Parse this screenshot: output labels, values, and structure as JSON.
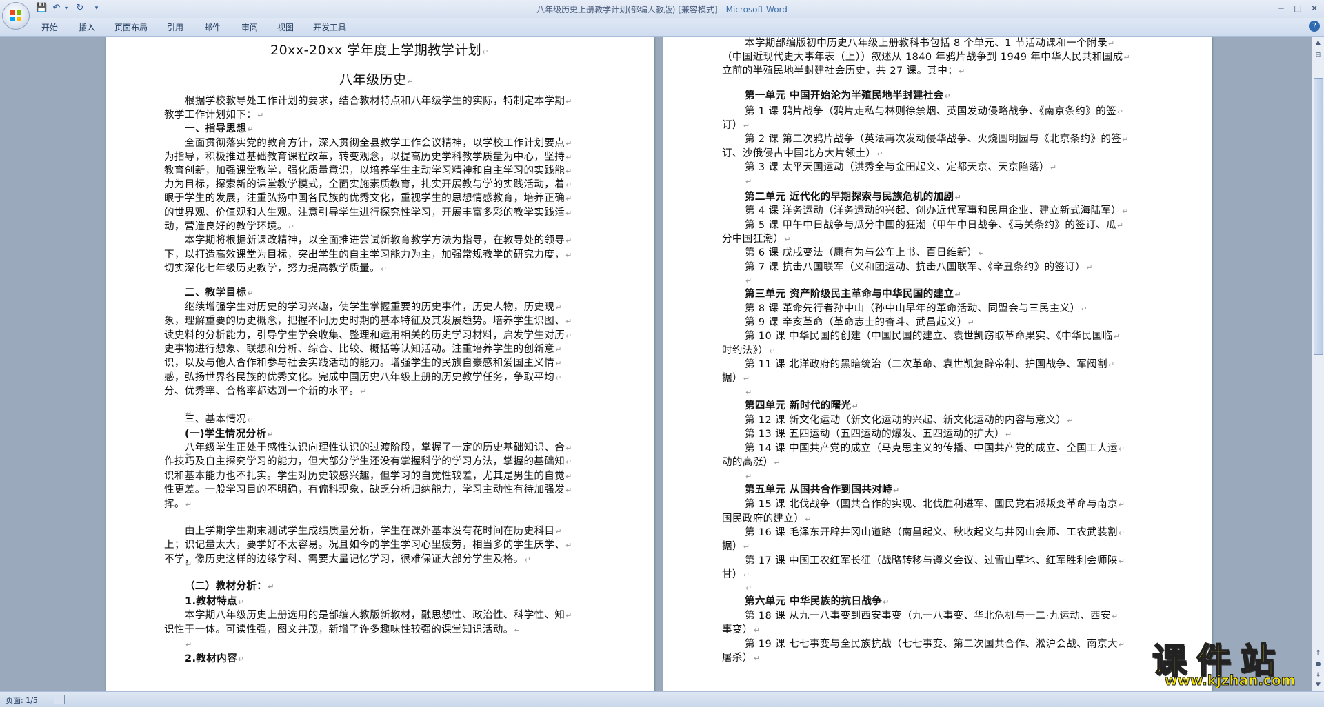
{
  "window": {
    "title": "八年级历史上册教学计划(部编人教版) [兼容模式] - ",
    "app_name": "Microsoft Word",
    "controls": [
      "─",
      "□",
      "✕"
    ]
  },
  "qat": {
    "save_icon": "save-icon",
    "undo_icon": "undo-icon",
    "redo_icon": "redo-icon"
  },
  "ribbon": {
    "tabs": [
      "开始",
      "插入",
      "页面布局",
      "引用",
      "邮件",
      "审阅",
      "视图",
      "开发工具"
    ],
    "help": "?"
  },
  "page1": {
    "lines": [
      {
        "t": "20xx-20xx 学年度上学期教学计划",
        "style": "title"
      },
      {
        "t": "八年级历史",
        "style": "title"
      },
      {
        "t": "根据学校教导处工作计划的要求，结合教材特点和八年级学生的实际，特制定本学期"
      },
      {
        "t": "教学工作计划如下："
      },
      {
        "t": "一、指导思想"
      },
      {
        "t": "全面贯彻落实党的教育方针，深入贯彻全县教学工作会议精神，以学校工作计划要点"
      },
      {
        "t": "为指导，积极推进基础教育课程改革，转变观念，以提高历史学科教学质量为中心，坚持"
      },
      {
        "t": "教育创新，加强课堂教学，强化质量意识，以培养学生主动学习精神和自主学习的实践能"
      },
      {
        "t": "力为目标，探索新的课堂教学模式，全面实施素质教育，扎实开展教与学的实践活动，着"
      },
      {
        "t": "眼于学生的发展，注重弘扬中国各民族的优秀文化，重视学生的思想情感教育，培养正确"
      },
      {
        "t": "的世界观、价值观和人生观。注意引导学生进行探究性学习，开展丰富多彩的教学实践活"
      },
      {
        "t": "动，营造良好的教学环境。"
      },
      {
        "t": "本学期将根据新课改精神，以全面推进尝试新教育教学方法为指导，在教导处的领导"
      },
      {
        "t": "下，以打造高效课堂为目标，突出学生的自主学习能力为主，加强常规教学的研究力度，"
      },
      {
        "t": "切实深化七年级历史教学，努力提高教学质量。"
      },
      {
        "t": "二、教学目标"
      },
      {
        "t": "继续增强学生对历史的学习兴趣，使学生掌握重要的历史事件，历史人物，历史现"
      },
      {
        "t": "象，理解重要的历史概念，把握不同历史时期的基本特征及其发展趋势。培养学生识图、"
      },
      {
        "t": "读史料的分析能力，引导学生学会收集、整理和运用相关的历史学习材料，启发学生对历"
      },
      {
        "t": "史事物进行想象、联想和分析、综合、比较、概括等认知活动。注重培养学生的创新意"
      },
      {
        "t": "识，以及与他人合作和参与社会实践活动的能力。增强学生的民族自豪感和爱国主义情"
      },
      {
        "t": "感，弘扬世界各民族的优秀文化。完成中国历史八年级上册的历史教学任务，争取平均"
      },
      {
        "t": "分、优秀率、合格率都达到一个新的水平。"
      },
      {
        "t": "三、基本情况"
      },
      {
        "t": "(一)学生情况分析"
      },
      {
        "t": "八年级学生正处于感性认识向理性认识的过渡阶段，掌握了一定的历史基础知识、合"
      },
      {
        "t": "作技巧及自主探究学习的能力，但大部分学生还没有掌握科学的学习方法，掌握的基础知"
      },
      {
        "t": "识和基本能力也不扎实。学生对历史较感兴趣，但学习的自觉性较差，尤其是男生的自觉"
      },
      {
        "t": "性更差。一般学习目的不明确，有偏科现象，缺乏分析归纳能力，学习主动性有待加强发"
      },
      {
        "t": "挥。"
      },
      {
        "t": "由上学期学生期末测试学生成绩质量分析，学生在课外基本没有花时间在历史科目"
      },
      {
        "t": "上；识记量太大，要学好不太容易。况且如今的学生学习心里疲劳，相当多的学生厌学、"
      },
      {
        "t": "不学，像历史这样的边缘学科、需要大量记忆学习，很难保证大部分学生及格。"
      },
      {
        "t": "（二）教材分析："
      },
      {
        "t": "1.教材特点"
      },
      {
        "t": "本学期八年级历史上册选用的是部编人教版新教材，融思想性、政治性、科学性、知"
      },
      {
        "t": "识性于一体。可读性强，图文并茂，新增了许多趣味性较强的课堂知识活动。"
      },
      {
        "t": "2.教材内容"
      }
    ]
  },
  "page2": {
    "lines": [
      {
        "t": "本学期部编版初中历史八年级上册教科书包括 8 个单元、1 节活动课和一个附录"
      },
      {
        "t": "（中国近现代史大事年表（上））叙述从 1840 年鸦片战争到 1949 年中华人民共和国成"
      },
      {
        "t": "立前的半殖民地半封建社会历史，共 27 课。其中："
      },
      {
        "t": "第一单元 中国开始沦为半殖民地半封建社会"
      },
      {
        "t": "第 1 课 鸦片战争（鸦片走私与林则徐禁烟、英国发动侵略战争、《南京条约》的签"
      },
      {
        "t": "订）"
      },
      {
        "t": "第 2 课 第二次鸦片战争（英法再次发动侵华战争、火烧圆明园与《北京条约》的签"
      },
      {
        "t": "订、沙俄侵占中国北方大片领土）"
      },
      {
        "t": "第 3 课 太平天国运动（洪秀全与金田起义、定都天京、天京陷落）"
      },
      {
        "t": "第二单元 近代化的早期探索与民族危机的加剧"
      },
      {
        "t": "第 4 课 洋务运动（洋务运动的兴起、创办近代军事和民用企业、建立新式海陆军）"
      },
      {
        "t": "第 5 课 甲午中日战争与瓜分中国的狂潮（甲午中日战争、《马关条约》的签订、瓜"
      },
      {
        "t": "分中国狂潮）"
      },
      {
        "t": "第 6 课 戊戌变法（康有为与公车上书、百日维新）"
      },
      {
        "t": "第 7 课 抗击八国联军（义和团运动、抗击八国联军、《辛丑条约》的签订）"
      },
      {
        "t": "第三单元 资产阶级民主革命与中华民国的建立"
      },
      {
        "t": "第 8 课 革命先行者孙中山（孙中山早年的革命活动、同盟会与三民主义）"
      },
      {
        "t": "第 9 课 辛亥革命（革命志士的奋斗、武昌起义）"
      },
      {
        "t": "第 10 课 中华民国的创建（中国民国的建立、袁世凯窃取革命果实、《中华民国临"
      },
      {
        "t": "时约法》）"
      },
      {
        "t": "第 11 课 北洋政府的黑暗统治（二次革命、袁世凯复辟帝制、护国战争、军阀割"
      },
      {
        "t": "据）"
      },
      {
        "t": "第四单元 新时代的曙光"
      },
      {
        "t": "第 12 课 新文化运动（新文化运动的兴起、新文化运动的内容与意义）"
      },
      {
        "t": "第 13 课 五四运动（五四运动的爆发、五四运动的扩大）"
      },
      {
        "t": "第 14 课 中国共产党的成立（马克思主义的传播、中国共产党的成立、全国工人运"
      },
      {
        "t": "动的高涨）"
      },
      {
        "t": "第五单元 从国共合作到国共对峙"
      },
      {
        "t": "第 15 课 北伐战争（国共合作的实现、北伐胜利进军、国民党右派叛变革命与南京"
      },
      {
        "t": "国民政府的建立）"
      },
      {
        "t": "第 16 课 毛泽东开辟井冈山道路（南昌起义、秋收起义与井冈山会师、工农武装割"
      },
      {
        "t": "据）"
      },
      {
        "t": "第 17 课 中国工农红军长征（战略转移与遵义会议、过雪山草地、红军胜利会师陕"
      },
      {
        "t": "甘）"
      },
      {
        "t": "第六单元 中华民族的抗日战争"
      },
      {
        "t": "第 18 课 从九一八事变到西安事变（九一八事变、华北危机与一二·九运动、西安"
      },
      {
        "t": "事变）"
      },
      {
        "t": "第 19 课 七七事变与全民族抗战（七七事变、第二次国共合作、淞沪会战、南京大"
      },
      {
        "t": "屠杀）"
      }
    ]
  },
  "status": {
    "page": "页面: 1/5"
  },
  "watermark": {
    "text": "课件站",
    "url": "www.kjzhan.com"
  }
}
